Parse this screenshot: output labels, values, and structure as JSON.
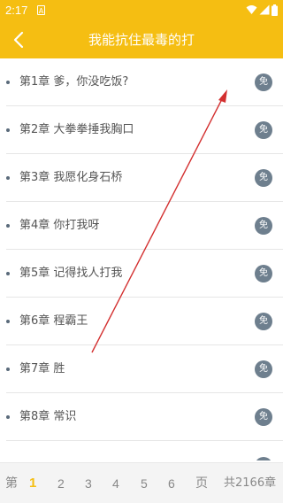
{
  "status_bar": {
    "time": "2:17",
    "sim_label": "A",
    "icons": [
      "sim-alert-icon",
      "wifi-icon",
      "cell-signal-icon",
      "battery-icon"
    ]
  },
  "header": {
    "title": "我能抗住最毒的打",
    "back_icon": "chevron-left-icon"
  },
  "chapters": [
    {
      "title": "第1章 爹，你没吃饭?",
      "badge": "免"
    },
    {
      "title": "第2章 大拳拳捶我胸口",
      "badge": "免"
    },
    {
      "title": "第3章 我愿化身石桥",
      "badge": "免"
    },
    {
      "title": "第4章 你打我呀",
      "badge": "免"
    },
    {
      "title": "第5章 记得找人打我",
      "badge": "免"
    },
    {
      "title": "第6章 程霸王",
      "badge": "免"
    },
    {
      "title": "第7章 胜",
      "badge": "免"
    },
    {
      "title": "第8章 常识",
      "badge": "免"
    }
  ],
  "pagination": {
    "prefix": "第",
    "pages": [
      "1",
      "2",
      "3",
      "4",
      "5",
      "6"
    ],
    "current_page": "1",
    "suffix": "页",
    "total": "共2166章"
  },
  "colors": {
    "accent": "#f5be12",
    "badge": "#6e7f8e",
    "annotation_arrow": "#d32f2f"
  }
}
